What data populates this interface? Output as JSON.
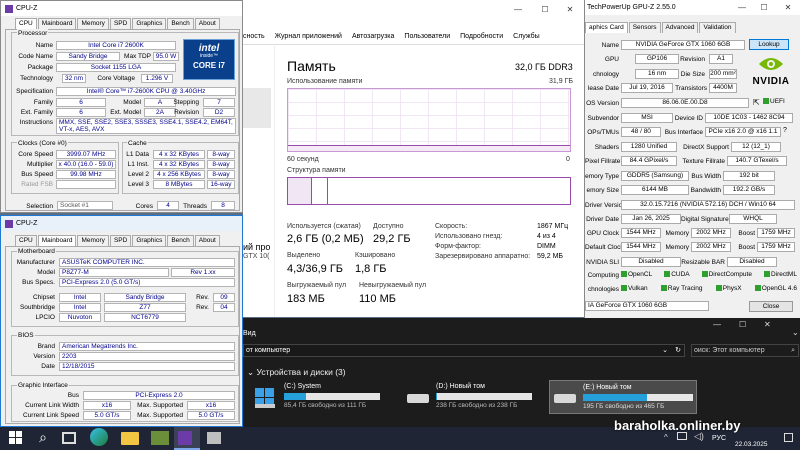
{
  "cpuz1": {
    "title": "CPU-Z",
    "tabs": [
      "CPU",
      "Mainboard",
      "Memory",
      "SPD",
      "Graphics",
      "Bench",
      "About"
    ],
    "processor_legend": "Processor",
    "name_l": "Name",
    "name": "Intel Core i7 2600K",
    "code_l": "Code Name",
    "code": "Sandy Bridge",
    "tdp_l": "Max TDP",
    "tdp": "95.0 W",
    "pkg_l": "Package",
    "pkg": "Socket 1155 LGA",
    "tech_l": "Technology",
    "tech": "32 nm",
    "cv_l": "Core Voltage",
    "cv": "1.296 V",
    "spec_l": "Specification",
    "spec": "Intel® Core™ i7-2600K CPU @ 3.40GHz",
    "fam_l": "Family",
    "fam": "6",
    "model_l": "Model",
    "model": "A",
    "step_l": "Stepping",
    "step": "7",
    "efam_l": "Ext. Family",
    "efam": "6",
    "emodel_l": "Ext. Model",
    "emodel": "2A",
    "rev_l": "Revision",
    "rev": "D2",
    "instr_l": "Instructions",
    "instr": "MMX, SSE, SSE2, SSE3, SSSE3, SSE4.1, SSE4.2, EM64T, VT-x, AES, AVX",
    "clocks_legend": "Clocks (Core #0)",
    "cs_l": "Core Speed",
    "cs": "3999.07 MHz",
    "mul_l": "Multiplier",
    "mul": "x 40.0 (16.0 - 59.0)",
    "bus_l": "Bus Speed",
    "bus": "99.98 MHz",
    "fsb_l": "Rated FSB",
    "cache_legend": "Cache",
    "l1d_l": "L1 Data",
    "l1d": "4 x 32 KBytes",
    "l1d_w": "8-way",
    "l1i_l": "L1 Inst.",
    "l1i": "4 x 32 KBytes",
    "l1i_w": "8-way",
    "l2_l": "Level 2",
    "l2": "4 x 256 KBytes",
    "l2_w": "8-way",
    "l3_l": "Level 3",
    "l3": "8 MBytes",
    "l3_w": "16-way",
    "sel_l": "Selection",
    "sel": "Socket #1",
    "cores_l": "Cores",
    "cores": "4",
    "threads_l": "Threads",
    "threads": "8",
    "logo_brand": "intel",
    "logo_inside": "inside™",
    "logo_core": "CORE i7"
  },
  "cpuz2": {
    "title": "CPU-Z",
    "tabs": [
      "CPU",
      "Mainboard",
      "Memory",
      "SPD",
      "Graphics",
      "Bench",
      "About"
    ],
    "mb_legend": "Motherboard",
    "man_l": "Manufacturer",
    "man": "ASUSTeK COMPUTER INC.",
    "model_l": "Model",
    "model": "P8Z77-M",
    "model_rev": "Rev 1.xx",
    "bus_l": "Bus Specs.",
    "bus": "PCI-Express 2.0 (5.0 GT/s)",
    "chip_l": "Chipset",
    "chip": "Intel",
    "chip2": "Sandy Bridge",
    "chip_rev_l": "Rev.",
    "chip_rev": "09",
    "sb_l": "Southbridge",
    "sb": "Intel",
    "sb2": "Z77",
    "sb_rev_l": "Rev.",
    "sb_rev": "04",
    "lpc_l": "LPCIO",
    "lpc": "Nuvoton",
    "lpc2": "NCT6779",
    "bios_legend": "BIOS",
    "brand_l": "Brand",
    "brand": "American Megatrends Inc.",
    "ver_l": "Version",
    "ver": "2203",
    "date_l": "Date",
    "date": "12/18/2015",
    "gi_legend": "Graphic Interface",
    "gbus_l": "Bus",
    "gbus": "PCI-Express 2.0",
    "clw_l": "Current Link Width",
    "clw": "x16",
    "msup_l": "Max. Supported",
    "msup": "x16",
    "cls_l": "Current Link Speed",
    "cls": "5.0 GT/s",
    "msup2_l": "Max. Supported",
    "msup2": "5.0 GT/s"
  },
  "taskmgr": {
    "tabs": [
      "сность",
      "Журнал приложений",
      "Автозагрузка",
      "Пользователи",
      "Подробности",
      "Службы"
    ],
    "title": "Память",
    "total": "32,0 ГБ DDR3",
    "usage_label": "Использование памяти",
    "usage_max": "31,9 ГБ",
    "time_left": "60 секунд",
    "time_right": "0",
    "struct_label": "Структура памяти",
    "used_usage": 0.09,
    "in_use_l": "Используется (сжатая)",
    "in_use": "2,6 ГБ (0,2 МБ)",
    "avail_l": "Доступно",
    "avail": "29,2 ГБ",
    "commit_l": "Выделено",
    "commit": "4,3/36,9 ГБ",
    "cached_l": "Кэшировано",
    "cached": "1,8 ГБ",
    "paged_l": "Выгружаемый пул",
    "paged": "183 МБ",
    "nonpaged_l": "Невыгружаемый пул",
    "nonpaged": "110 МБ",
    "speed_l": "Скорость:",
    "speed": "1867 МГц",
    "slots_l": "Использовано гнезд:",
    "slots": "4 из 4",
    "form_l": "Форм-фактор:",
    "form": "DIMM",
    "reserved_l": "Зарезервировано аппаратно:",
    "reserved": "59,2 МБ",
    "side_text1": "ий про",
    "side_text2": "GTX 10("
  },
  "gpuz": {
    "title": "TechPowerUp GPU-Z 2.55.0",
    "tabs": [
      "aphics Card",
      "Sensors",
      "Advanced",
      "Validation"
    ],
    "name_l": "Name",
    "name": "NVIDIA GeForce GTX 1060 6GB",
    "lookup": "Lookup",
    "gpu_l": "GPU",
    "gpu": "GP106",
    "rev_l": "Revision",
    "rev": "A1",
    "tech_l": "chnology",
    "tech": "16 nm",
    "die_l": "Die Size",
    "die": "200 mm²",
    "rel_l": "lease Date",
    "rel": "Jul 19, 2016",
    "trans_l": "Transistors",
    "trans": "4400M",
    "bios_l": "OS Version",
    "bios": "86.06.0E.00.D8",
    "uefi": "UEFI",
    "sub_l": "Subvendor",
    "sub": "MSI",
    "did_l": "Device ID",
    "did": "10DE 1C03 - 1462 8C94",
    "rops_l": "OPs/TMUs",
    "rops": "48 / 80",
    "bi_l": "Bus Interface",
    "bi": "PCIe x16 2.0 @ x16 1.1",
    "shd_l": "Shaders",
    "shd": "1280 Unified",
    "dx_l": "DirectX Support",
    "dx": "12 (12_1)",
    "pf_l": "Pixel Fillrate",
    "pf": "84.4 GPixel/s",
    "tf_l": "Texture Fillrate",
    "tf": "140.7 GTexel/s",
    "mt_l": "emory Type",
    "mt": "GDDR5 (Samsung)",
    "bw_l": "Bus Width",
    "bw": "192 bit",
    "ms_l": "emory Size",
    "ms": "6144 MB",
    "bdw_l": "Bandwidth",
    "bdw": "192.2 GB/s",
    "dv_l": "Driver Version",
    "dv": "32.0.15.7216 (NVIDIA 572.16) DCH / Win10 64",
    "dd_l": "Driver Date",
    "dd": "Jan 26, 2025",
    "ds_l": "Digital Signature",
    "ds": "WHQL",
    "gc_l": "GPU Clock",
    "gc": "1544 MHz",
    "mem_l": "Memory",
    "mem": "2002 MHz",
    "bst_l": "Boost",
    "bst": "1759 MHz",
    "dc_l": "Default Clock",
    "dc": "1544 MHz",
    "mem2_l": "Memory",
    "mem2": "2002 MHz",
    "bst2_l": "Boost",
    "bst2": "1759 MHz",
    "sli_l": "NVIDIA SLI",
    "sli": "Disabled",
    "rbar_l": "Resizable BAR",
    "rbar": "Disabled",
    "comp_l": "Computing",
    "comp": [
      "OpenCL",
      "CUDA",
      "DirectCompute",
      "DirectML"
    ],
    "tech2_l": "chnologies",
    "tech2": [
      "Vulkan",
      "Ray Tracing",
      "PhysX",
      "OpenGL 4.6"
    ],
    "select": "IA GeForce GTX 1060 6GB",
    "close": "Close",
    "logo": "NVIDIA"
  },
  "explorer": {
    "menu": "Вид",
    "addr": "от компьютер",
    "search": "оиск: Этот компьютер",
    "section": "Устройства и диски (3)",
    "drives": [
      {
        "name": "(C:) System",
        "free": "85,4 ГБ свободно из 111 ГБ",
        "fill": 0.23
      },
      {
        "name": "(D:) Новый том",
        "free": "238 ГБ свободно из 238 ГБ",
        "fill": 0.01
      },
      {
        "name": "(E:) Новый том",
        "free": "195 ГБ свободно из 465 ГБ",
        "fill": 0.58
      }
    ]
  },
  "taskbar": {
    "watermark": "baraholka.onliner.by",
    "lang": "РУС",
    "date": "22.03.2025"
  },
  "colors": {
    "intel_blue": "#0068b5",
    "nvidia_green": "#76b900",
    "memory_purple": "#9a4aab",
    "drive_bar": "#26a0da",
    "taskbar": "#1f2535"
  }
}
